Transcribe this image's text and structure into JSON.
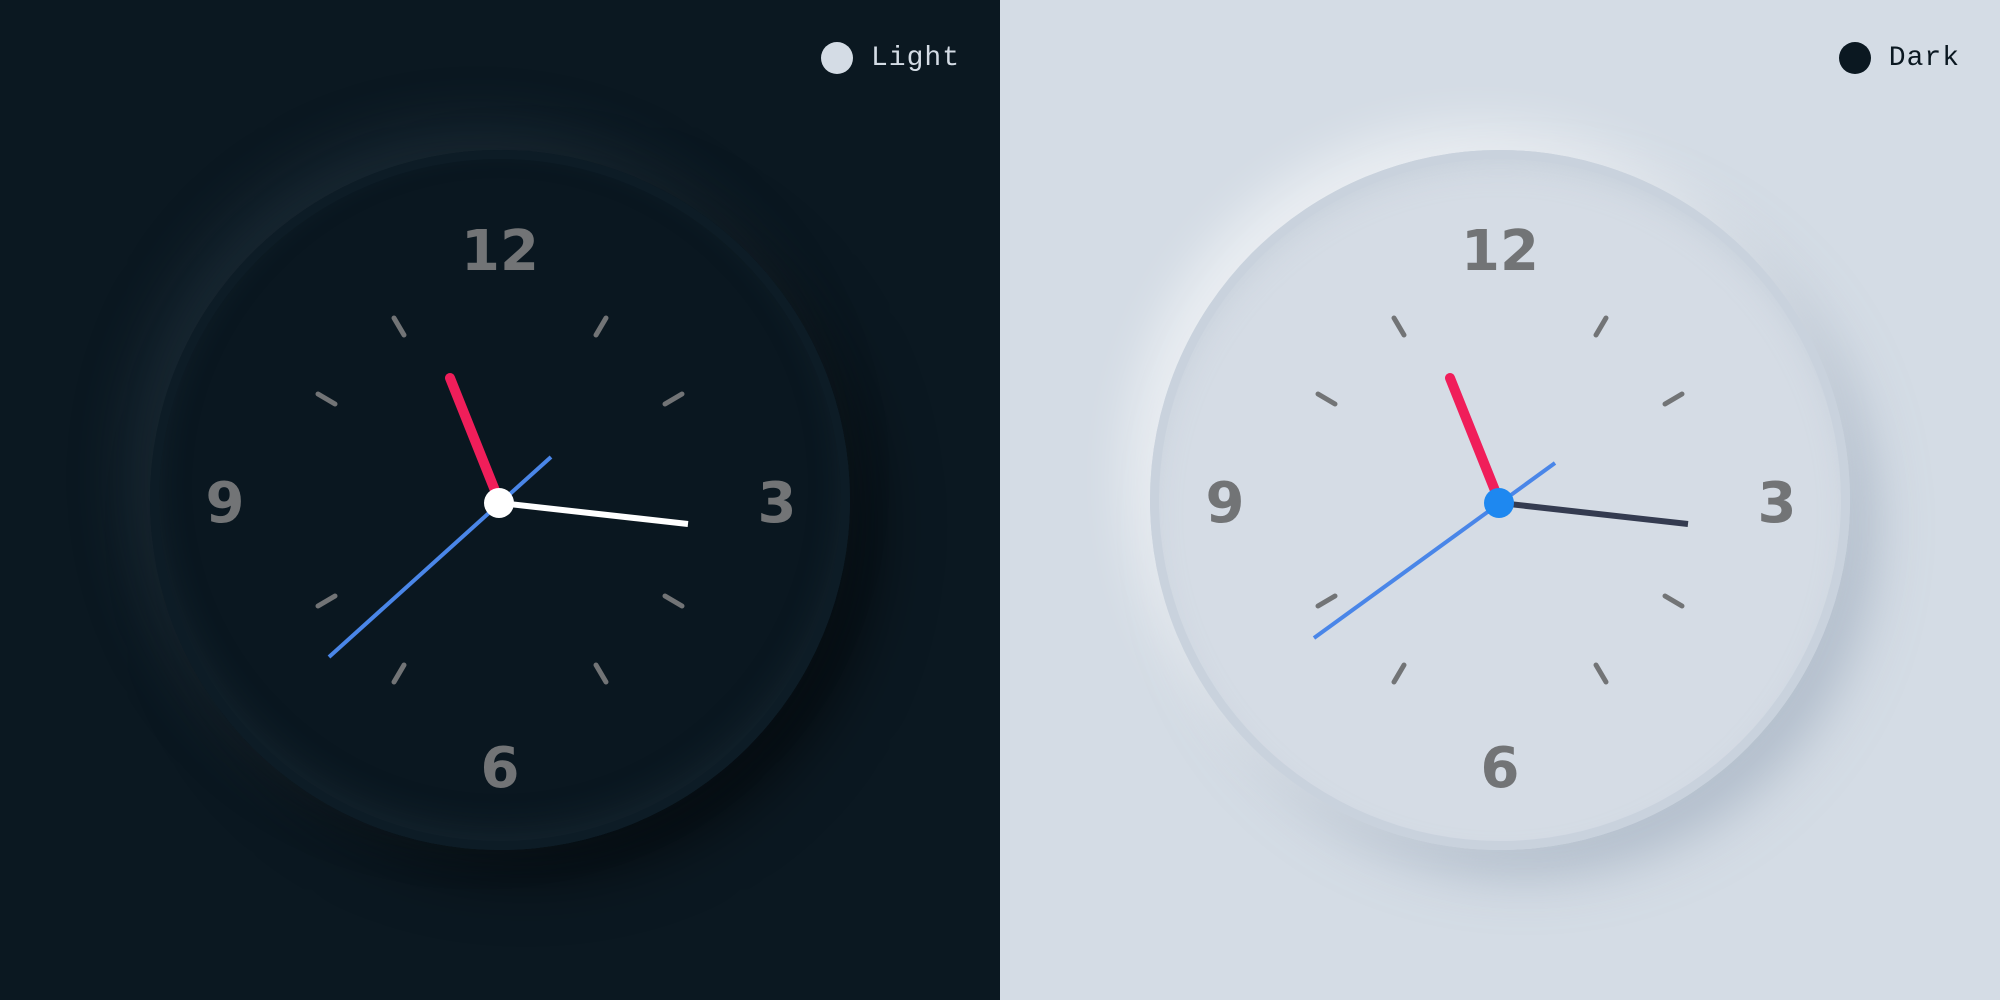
{
  "panels": [
    {
      "theme": "dark",
      "toggle_label": "Light",
      "colors": {
        "background": "#0b1821",
        "second_hand": "#ffffff",
        "minute_hand": "#4a86e8",
        "hour_hand": "#f01e5a",
        "center_cap": "#ffffff"
      }
    },
    {
      "theme": "light",
      "toggle_label": "Dark",
      "colors": {
        "background": "#d4dce5",
        "second_hand": "#343b50",
        "minute_hand": "#4a86e8",
        "hour_hand": "#f01e5a",
        "center_cap": "#1e88f0"
      }
    }
  ],
  "clock_numerals": [
    "12",
    "3",
    "6",
    "9"
  ],
  "time_shown": {
    "hour": 10,
    "minute": 41,
    "second": 16
  }
}
